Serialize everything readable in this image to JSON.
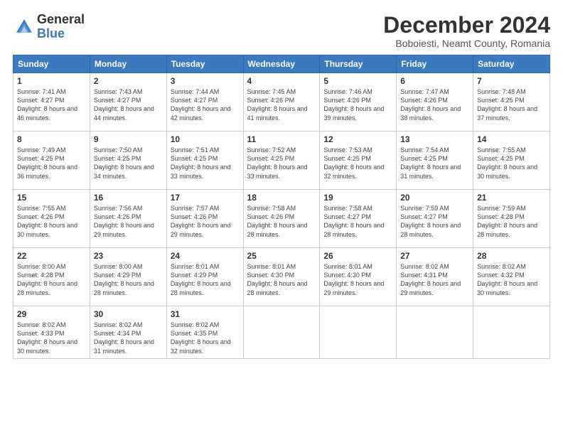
{
  "logo": {
    "general": "General",
    "blue": "Blue"
  },
  "header": {
    "month": "December 2024",
    "location": "Boboiesti, Neamt County, Romania"
  },
  "days_of_week": [
    "Sunday",
    "Monday",
    "Tuesday",
    "Wednesday",
    "Thursday",
    "Friday",
    "Saturday"
  ],
  "weeks": [
    [
      {
        "day": "1",
        "sunrise": "7:41 AM",
        "sunset": "4:27 PM",
        "daylight": "8 hours and 46 minutes."
      },
      {
        "day": "2",
        "sunrise": "7:43 AM",
        "sunset": "4:27 PM",
        "daylight": "8 hours and 44 minutes."
      },
      {
        "day": "3",
        "sunrise": "7:44 AM",
        "sunset": "4:27 PM",
        "daylight": "8 hours and 42 minutes."
      },
      {
        "day": "4",
        "sunrise": "7:45 AM",
        "sunset": "4:26 PM",
        "daylight": "8 hours and 41 minutes."
      },
      {
        "day": "5",
        "sunrise": "7:46 AM",
        "sunset": "4:26 PM",
        "daylight": "8 hours and 39 minutes."
      },
      {
        "day": "6",
        "sunrise": "7:47 AM",
        "sunset": "4:26 PM",
        "daylight": "8 hours and 38 minutes."
      },
      {
        "day": "7",
        "sunrise": "7:48 AM",
        "sunset": "4:25 PM",
        "daylight": "8 hours and 37 minutes."
      }
    ],
    [
      {
        "day": "8",
        "sunrise": "7:49 AM",
        "sunset": "4:25 PM",
        "daylight": "8 hours and 36 minutes."
      },
      {
        "day": "9",
        "sunrise": "7:50 AM",
        "sunset": "4:25 PM",
        "daylight": "8 hours and 34 minutes."
      },
      {
        "day": "10",
        "sunrise": "7:51 AM",
        "sunset": "4:25 PM",
        "daylight": "8 hours and 33 minutes."
      },
      {
        "day": "11",
        "sunrise": "7:52 AM",
        "sunset": "4:25 PM",
        "daylight": "8 hours and 33 minutes."
      },
      {
        "day": "12",
        "sunrise": "7:53 AM",
        "sunset": "4:25 PM",
        "daylight": "8 hours and 32 minutes."
      },
      {
        "day": "13",
        "sunrise": "7:54 AM",
        "sunset": "4:25 PM",
        "daylight": "8 hours and 31 minutes."
      },
      {
        "day": "14",
        "sunrise": "7:55 AM",
        "sunset": "4:25 PM",
        "daylight": "8 hours and 30 minutes."
      }
    ],
    [
      {
        "day": "15",
        "sunrise": "7:55 AM",
        "sunset": "4:26 PM",
        "daylight": "8 hours and 30 minutes."
      },
      {
        "day": "16",
        "sunrise": "7:56 AM",
        "sunset": "4:26 PM",
        "daylight": "8 hours and 29 minutes."
      },
      {
        "day": "17",
        "sunrise": "7:57 AM",
        "sunset": "4:26 PM",
        "daylight": "8 hours and 29 minutes."
      },
      {
        "day": "18",
        "sunrise": "7:58 AM",
        "sunset": "4:26 PM",
        "daylight": "8 hours and 28 minutes."
      },
      {
        "day": "19",
        "sunrise": "7:58 AM",
        "sunset": "4:27 PM",
        "daylight": "8 hours and 28 minutes."
      },
      {
        "day": "20",
        "sunrise": "7:59 AM",
        "sunset": "4:27 PM",
        "daylight": "8 hours and 28 minutes."
      },
      {
        "day": "21",
        "sunrise": "7:59 AM",
        "sunset": "4:28 PM",
        "daylight": "8 hours and 28 minutes."
      }
    ],
    [
      {
        "day": "22",
        "sunrise": "8:00 AM",
        "sunset": "4:28 PM",
        "daylight": "8 hours and 28 minutes."
      },
      {
        "day": "23",
        "sunrise": "8:00 AM",
        "sunset": "4:29 PM",
        "daylight": "8 hours and 28 minutes."
      },
      {
        "day": "24",
        "sunrise": "8:01 AM",
        "sunset": "4:29 PM",
        "daylight": "8 hours and 28 minutes."
      },
      {
        "day": "25",
        "sunrise": "8:01 AM",
        "sunset": "4:30 PM",
        "daylight": "8 hours and 28 minutes."
      },
      {
        "day": "26",
        "sunrise": "8:01 AM",
        "sunset": "4:30 PM",
        "daylight": "8 hours and 29 minutes."
      },
      {
        "day": "27",
        "sunrise": "8:02 AM",
        "sunset": "4:31 PM",
        "daylight": "8 hours and 29 minutes."
      },
      {
        "day": "28",
        "sunrise": "8:02 AM",
        "sunset": "4:32 PM",
        "daylight": "8 hours and 30 minutes."
      }
    ],
    [
      {
        "day": "29",
        "sunrise": "8:02 AM",
        "sunset": "4:33 PM",
        "daylight": "8 hours and 30 minutes."
      },
      {
        "day": "30",
        "sunrise": "8:02 AM",
        "sunset": "4:34 PM",
        "daylight": "8 hours and 31 minutes."
      },
      {
        "day": "31",
        "sunrise": "8:02 AM",
        "sunset": "4:35 PM",
        "daylight": "8 hours and 32 minutes."
      },
      null,
      null,
      null,
      null
    ]
  ],
  "labels": {
    "sunrise": "Sunrise:",
    "sunset": "Sunset:",
    "daylight": "Daylight:"
  }
}
